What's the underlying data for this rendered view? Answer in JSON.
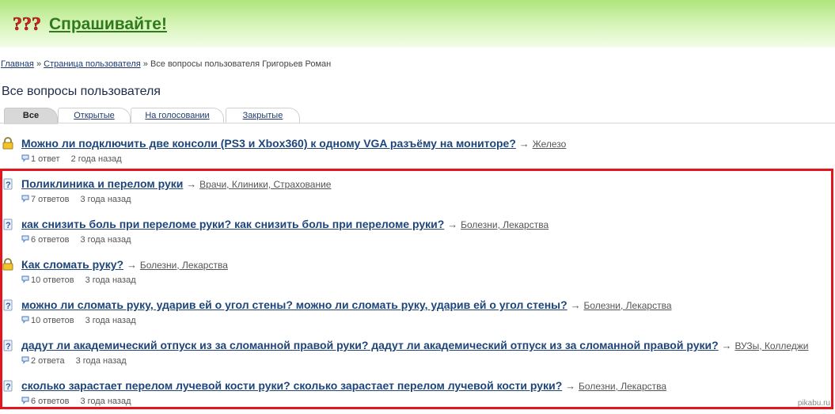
{
  "header": {
    "site_title": "Спрашивайте!",
    "accent": "#2f7a1b"
  },
  "breadcrumb": {
    "home": "Главная",
    "sep1": "»",
    "user_page": "Страница пользователя",
    "sep2": "»",
    "current": "Все вопросы пользователя Григорьев Роман"
  },
  "page_title": "Все вопросы пользователя",
  "tabs": [
    {
      "label": "Все",
      "active": true
    },
    {
      "label": "Открытые",
      "active": false
    },
    {
      "label": "На голосовании",
      "active": false
    },
    {
      "label": "Закрытые",
      "active": false
    }
  ],
  "arrow": "→",
  "questions": [
    {
      "icon": "lock-icon",
      "title": "Можно ли подключить две консоли (PS3 и Xbox360) к одному VGA разъёму на мониторе?",
      "category": "Железо",
      "answers": "1 ответ",
      "time": "2 года назад"
    },
    {
      "icon": "question-icon",
      "title": "Поликлиника и перелом руки",
      "category": "Врачи, Клиники, Страхование",
      "answers": "7 ответов",
      "time": "3 года назад"
    },
    {
      "icon": "question-icon",
      "title": "как снизить боль при переломе руки? как снизить боль при переломе руки?",
      "category": "Болезни, Лекарства",
      "answers": "6 ответов",
      "time": "3 года назад"
    },
    {
      "icon": "lock-icon",
      "title": "Как сломать руку?",
      "category": "Болезни, Лекарства",
      "answers": "10 ответов",
      "time": "3 года назад"
    },
    {
      "icon": "question-icon",
      "title": "можно ли сломать руку, ударив ей о угол стены? можно ли сломать руку, ударив ей о угол стены?",
      "category": "Болезни, Лекарства",
      "answers": "10 ответов",
      "time": "3 года назад"
    },
    {
      "icon": "question-icon",
      "title": "дадут ли академический отпуск из за сломанной правой руки? дадут ли академический отпуск из за сломанной правой руки?",
      "category": "ВУЗы, Колледжи",
      "answers": "2 ответа",
      "time": "3 года назад"
    },
    {
      "icon": "question-icon",
      "title": "сколько зарастает перелом лучевой кости руки? сколько зарастает перелом лучевой кости руки?",
      "category": "Болезни, Лекарства",
      "answers": "6 ответов",
      "time": "3 года назад"
    }
  ],
  "highlight_color": "#e3161e",
  "watermark": "pikabu.ru"
}
